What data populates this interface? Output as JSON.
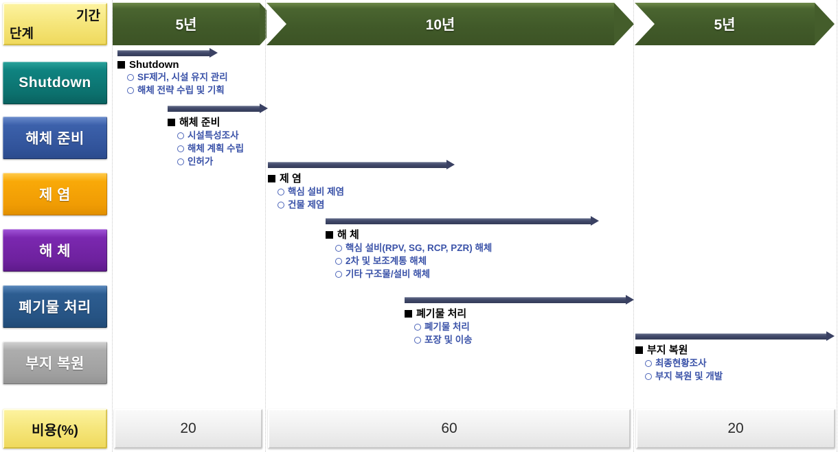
{
  "legend": {
    "period_label": "기간",
    "stage_label": "단계"
  },
  "timeline": {
    "columns": [
      {
        "duration": "5년",
        "cost": "20"
      },
      {
        "duration": "10년",
        "cost": "60"
      },
      {
        "duration": "5년",
        "cost": "20"
      }
    ]
  },
  "stages": [
    {
      "key": "shutdown",
      "label": "Shutdown",
      "color": "#138581"
    },
    {
      "key": "dismantle-prep",
      "label": "해체 준비",
      "color": "#3a5fa8"
    },
    {
      "key": "decontamination",
      "label": "제 염",
      "color": "#f5a608"
    },
    {
      "key": "dismantling",
      "label": "해 체",
      "color": "#7326a8"
    },
    {
      "key": "waste-treatment",
      "label": "폐기물 처리",
      "color": "#2b5788"
    },
    {
      "key": "site-restoration",
      "label": "부지 복원",
      "color": "#a6a6a6"
    }
  ],
  "phases": [
    {
      "key": "shutdown",
      "title": "Shutdown",
      "items": [
        "SF제거, 시설 유지 관리",
        "해체 전략 수립 및 기획"
      ]
    },
    {
      "key": "dismantle-prep",
      "title": "해체 준비",
      "items": [
        "시설특성조사",
        "해체 계획 수립",
        "인허가"
      ]
    },
    {
      "key": "decontamination",
      "title": "제 염",
      "items": [
        "핵심 설비 제염",
        "건물 제염"
      ]
    },
    {
      "key": "dismantling",
      "title": "해 체",
      "items": [
        "핵심 설비(RPV, SG, RCP, PZR) 해체",
        "2차 및 보조계통 해체",
        "기타 구조물/설비 해체"
      ]
    },
    {
      "key": "waste-treatment",
      "title": "폐기물 처리",
      "items": [
        "폐기물 처리",
        "포장 및 이송"
      ]
    },
    {
      "key": "site-restoration",
      "title": "부지 복원",
      "items": [
        "최종현황조사",
        "부지 복원 및 개발"
      ]
    }
  ],
  "cost_row": {
    "label": "비용(%)",
    "values": [
      "20",
      "60",
      "20"
    ]
  }
}
